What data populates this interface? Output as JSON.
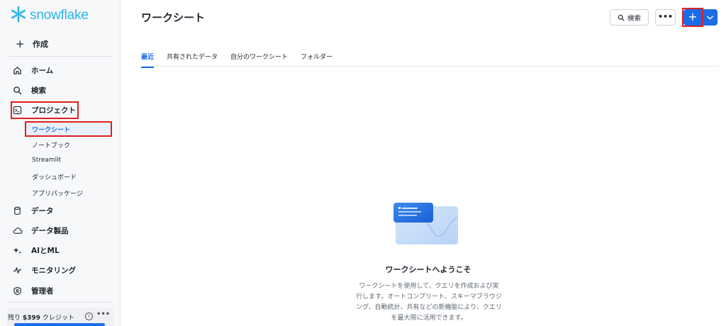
{
  "app": {
    "logo_text": "snowflake",
    "accent": "#1a6ce7",
    "logo_color": "#29b5e8"
  },
  "sidebar": {
    "create_label": "作成",
    "items": [
      {
        "label": "ホーム",
        "icon": "home-icon"
      },
      {
        "label": "検索",
        "icon": "search-icon"
      },
      {
        "label": "プロジェクト",
        "icon": "terminal-icon"
      },
      {
        "label": "データ",
        "icon": "database-icon"
      },
      {
        "label": "データ製品",
        "icon": "cloud-icon"
      },
      {
        "label": "AIとML",
        "icon": "sparkle-icon"
      },
      {
        "label": "モニタリング",
        "icon": "activity-icon"
      },
      {
        "label": "管理者",
        "icon": "shield-icon"
      }
    ],
    "project_sub_items": [
      "ワークシート",
      "ノートブック",
      "Streamlit",
      "ダッシュボード",
      "アプリパッケージ"
    ],
    "credit": {
      "prefix": "残り",
      "amount": "$399",
      "suffix": "クレジット"
    }
  },
  "header": {
    "title": "ワークシート",
    "search_label": "検索",
    "more_label": "•••",
    "add_label": "+"
  },
  "tabs": [
    "最近",
    "共有されたデータ",
    "自分のワークシート",
    "フォルダー"
  ],
  "empty_state": {
    "title": "ワークシートへようこそ",
    "lines": [
      "ワークシートを使用して、クエリを作成および実",
      "行します。オートコンプリート、スキーマブラウジ",
      "ング、自動統計、共有などの新機能により、クエリ",
      "を最大限に活用できます。"
    ]
  }
}
